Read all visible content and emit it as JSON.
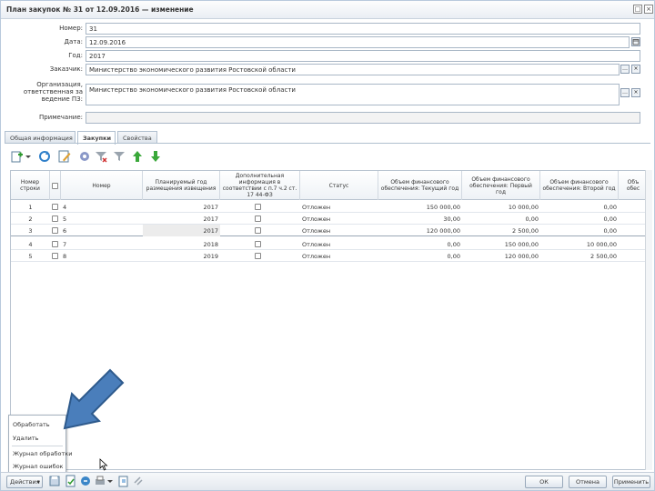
{
  "window": {
    "title": "План закупок № 31 от 12.09.2016 — изменение",
    "maximize_icon": "□",
    "close_icon": "×"
  },
  "form": {
    "number": {
      "label": "Номер:",
      "value": "31"
    },
    "date": {
      "label": "Дата:",
      "value": "12.09.2016"
    },
    "year": {
      "label": "Год:",
      "value": "2017"
    },
    "customer": {
      "label": "Заказчик:",
      "value": "Министерство экономического развития Ростовской области"
    },
    "responsible_org": {
      "label": "Организация, ответственная за ведение ПЗ:",
      "value": "Министерство экономического развития Ростовской области"
    },
    "note": {
      "label": "Примечание:",
      "value": ""
    }
  },
  "tabs": [
    "Общая информация",
    "Закупки",
    "Свойства"
  ],
  "table": {
    "columns": [
      "Номер строки",
      "",
      "Номер",
      "Планируемый год размещения извещения",
      "Дополнительная информация в соответствии с п.7 ч.2 ст. 17 44-ФЗ",
      "Статус",
      "Объем финансового обеспечения: Текущий год",
      "Объем финансового обеспечения: Первый год",
      "Объем финансового обеспечения: Второй год",
      "Объ обес"
    ],
    "rows": [
      {
        "line": "1",
        "number": "4",
        "year": "2017",
        "status": "Отложен",
        "current": "150 000,00",
        "first": "10 000,00",
        "second": "0,00"
      },
      {
        "line": "2",
        "number": "5",
        "year": "2017",
        "status": "Отложен",
        "current": "30,00",
        "first": "0,00",
        "second": "0,00"
      },
      {
        "line": "3",
        "number": "6",
        "year": "2017",
        "status": "Отложен",
        "current": "120 000,00",
        "first": "2 500,00",
        "second": "0,00"
      },
      {
        "line": "4",
        "number": "7",
        "year": "2018",
        "status": "Отложен",
        "current": "0,00",
        "first": "150 000,00",
        "second": "10 000,00"
      },
      {
        "line": "5",
        "number": "8",
        "year": "2019",
        "status": "Отложен",
        "current": "0,00",
        "first": "120 000,00",
        "second": "2 500,00"
      }
    ]
  },
  "popup_menu": {
    "items": [
      "Обработать",
      "Удалить",
      "Журнал обработки",
      "Журнал ошибок"
    ]
  },
  "bottom": {
    "actions_label": "Действия",
    "ok": "ОК",
    "cancel": "Отмена",
    "apply": "Применить"
  },
  "colors": {
    "arrow": "#4a7ebb",
    "arrow_border": "#2e5a8c",
    "header_bg": "#eef2f6"
  },
  "icons": [
    "add-row-icon",
    "refresh-icon",
    "edit-icon",
    "settings-icon",
    "filter-clear-icon",
    "filter-icon",
    "move-up-icon",
    "move-down-icon"
  ]
}
